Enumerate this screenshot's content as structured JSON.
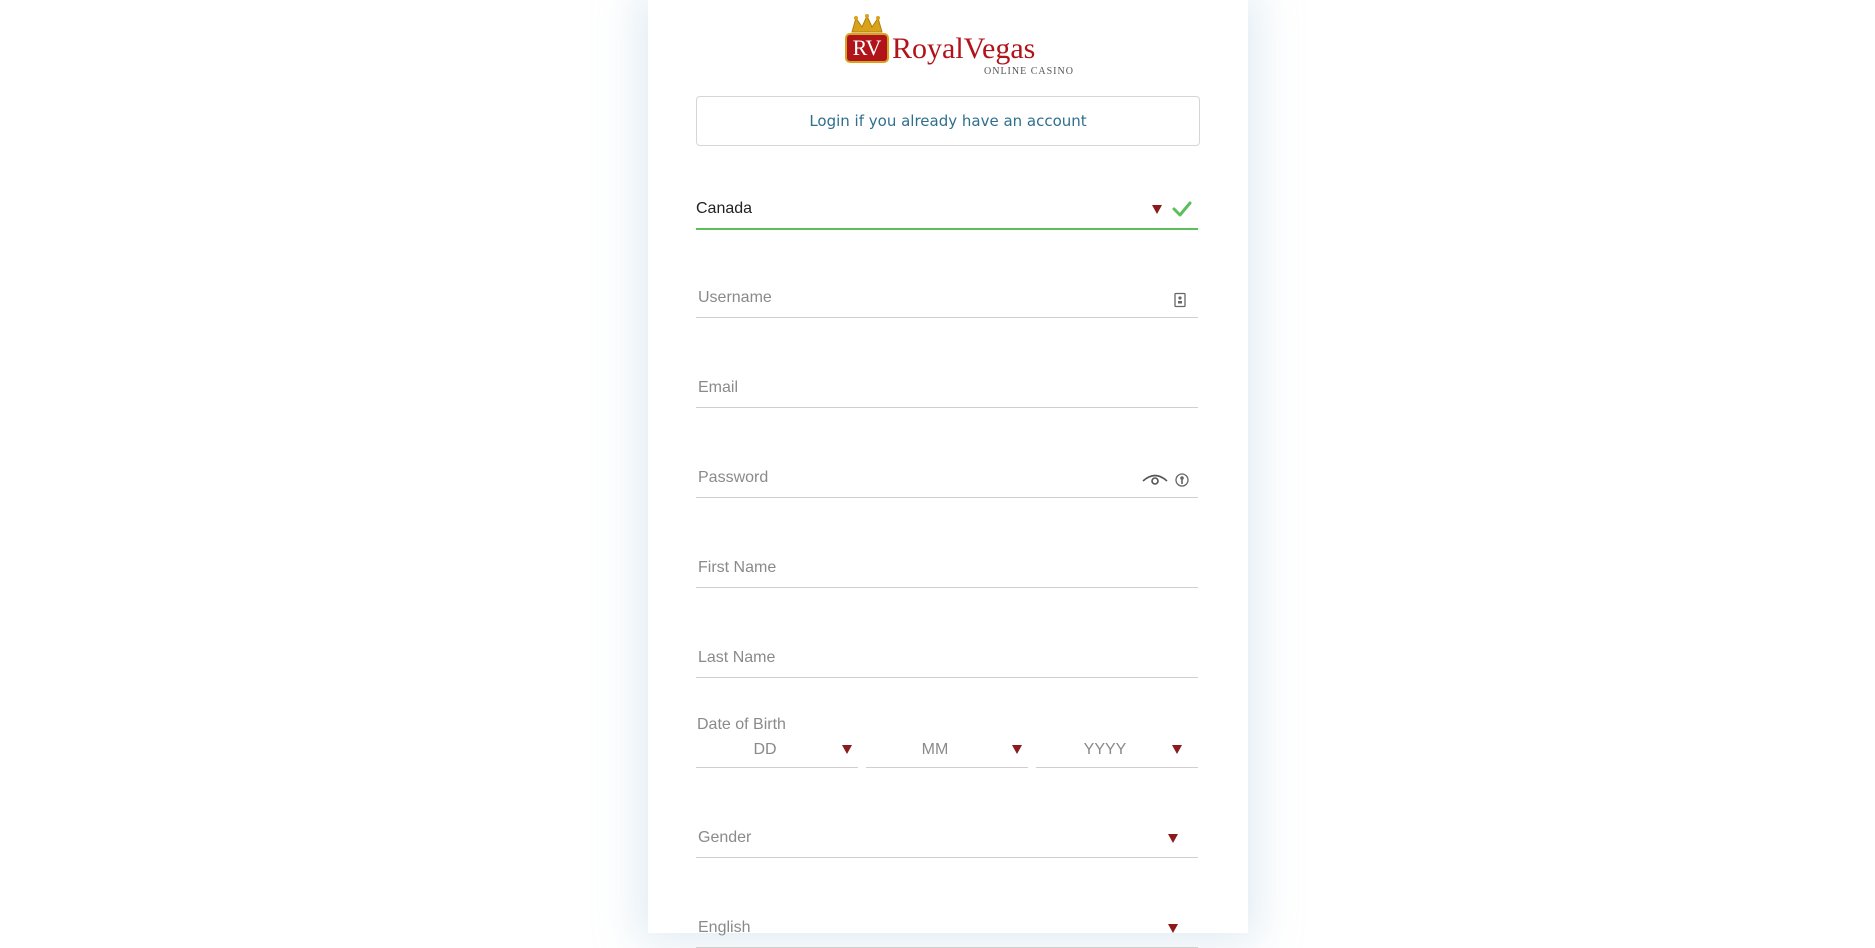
{
  "brand": {
    "logo_rv": "RV",
    "logo_name": "RoyalVegas",
    "logo_tagline": "ONLINE CASINO"
  },
  "login": {
    "label": "Login if you already have an account"
  },
  "form": {
    "country": {
      "value": "Canada"
    },
    "username": {
      "placeholder": "Username"
    },
    "email": {
      "placeholder": "Email"
    },
    "password": {
      "placeholder": "Password"
    },
    "first_name": {
      "placeholder": "First Name"
    },
    "last_name": {
      "placeholder": "Last Name"
    },
    "dob": {
      "label": "Date of Birth",
      "day": "DD",
      "month": "MM",
      "year": "YYYY"
    },
    "gender": {
      "placeholder": "Gender"
    },
    "language": {
      "value": "English"
    }
  },
  "colors": {
    "accent_link": "#2f6f8e",
    "caret": "#8b1a1a",
    "valid": "#5cbf5c",
    "brand_red": "#b0141a",
    "brand_gold": "#d9a21b"
  },
  "icons": {
    "country_caret": "caret-down-icon",
    "country_valid": "checkmark-icon",
    "username_icon": "id-card-icon",
    "password_show": "eye-icon",
    "password_key": "key-icon"
  }
}
